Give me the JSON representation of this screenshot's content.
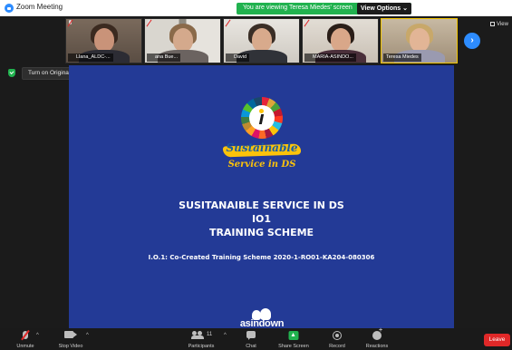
{
  "window": {
    "title": "Zoom Meeting"
  },
  "share_banner": {
    "message": "You are viewing Teresa Miedes' screen",
    "view_options": "View Options ⌄"
  },
  "gallery": {
    "participants": [
      {
        "name": "Llana_ALDC-..."
      },
      {
        "name": "ana Bue..."
      },
      {
        "name": "David"
      },
      {
        "name": "MARIA-ASINDO..."
      },
      {
        "name": "Teresa Miedes"
      }
    ],
    "next_icon": "chevron-right-icon",
    "view_label": "View"
  },
  "interpretation": {
    "label": "Turn on Original Sound",
    "caret": "▾"
  },
  "slide": {
    "logo_line1": "Sustainable",
    "logo_line2": "Service in DS",
    "title_lines": [
      "SUSITANAIBLE SERVICE IN DS",
      "IO1",
      "TRAINING SCHEME"
    ],
    "reference": "I.O.1: Co-Created Training Scheme 2020-1-RO01-KA204-080306",
    "org_logo_text": "asindown"
  },
  "toolbar": {
    "unmute": "Unmute",
    "stop_video": "Stop Video",
    "participants": "Participants",
    "participant_count": "11",
    "chat": "Chat",
    "share_screen": "Share Screen",
    "record": "Record",
    "reactions": "Reactions",
    "leave": "Leave",
    "caret": "^"
  },
  "colors": {
    "zoom_blue": "#2d8cff",
    "banner_green": "#21b24f",
    "slide_background": "#233a96",
    "leave_red": "#e02828",
    "logo_yellow": "#fcc30b"
  }
}
